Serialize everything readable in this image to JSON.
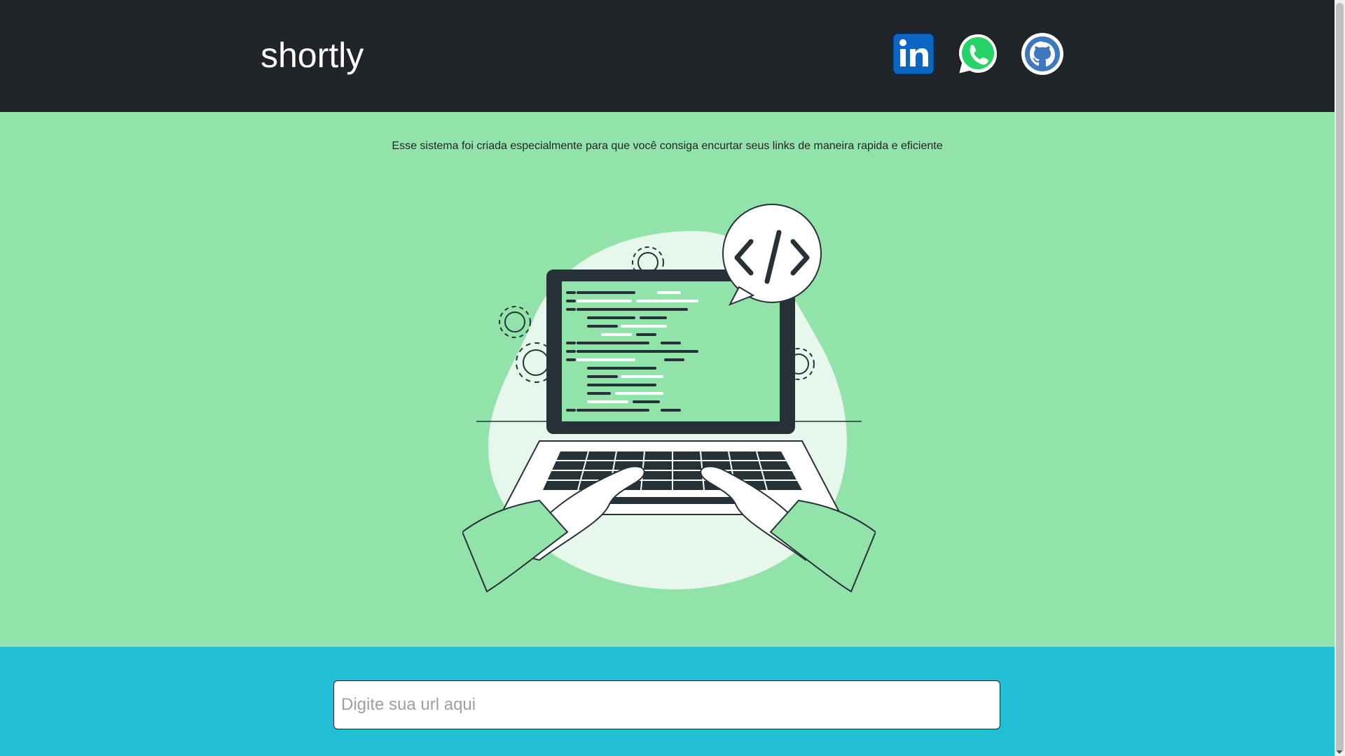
{
  "header": {
    "brand": "shortly",
    "social_links": [
      {
        "name": "linkedin",
        "icon": "linkedin-icon",
        "color": "#0a66c2"
      },
      {
        "name": "whatsapp",
        "icon": "whatsapp-icon",
        "color": "#25d366"
      },
      {
        "name": "github",
        "icon": "github-icon",
        "color": "#4078c0"
      }
    ]
  },
  "hero": {
    "tagline": "Esse sistema foi criada especialmente para que você consiga encurtar seus links de maneira rapida e eficiente",
    "illustration": "laptop-coding-illustration"
  },
  "form": {
    "url_placeholder": "Digite sua url aqui"
  },
  "colors": {
    "header_bg": "#212529",
    "hero_bg": "#92e3a9",
    "form_bg": "#25bed7",
    "text_dark": "#212529"
  }
}
